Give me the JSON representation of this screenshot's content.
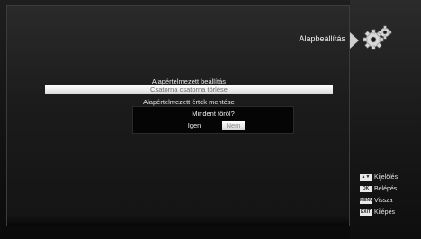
{
  "header": {
    "title": "Alapbeállítás",
    "icon": "gear-icon"
  },
  "menu": {
    "items": [
      {
        "label": "Alapértelmezett beállítás"
      },
      {
        "label": "Csatorna csatorna törlése"
      },
      {
        "label": "Alapértelmezett érték mentése"
      }
    ],
    "selected_index": 1
  },
  "dialog": {
    "message": "Mindent töröl?",
    "yes_label": "Igen",
    "no_label": "Nem",
    "focused": "no"
  },
  "legend": [
    {
      "key": "▲▼",
      "label": "Kijelölés"
    },
    {
      "key": "OK",
      "label": "Belépés"
    },
    {
      "key": "MENU",
      "label": "Vissza"
    },
    {
      "key": "EXIT",
      "label": "Kilépés"
    }
  ],
  "colors": {
    "highlight": "#ffffff",
    "background": "#141414",
    "text": "#e6e6e6"
  }
}
